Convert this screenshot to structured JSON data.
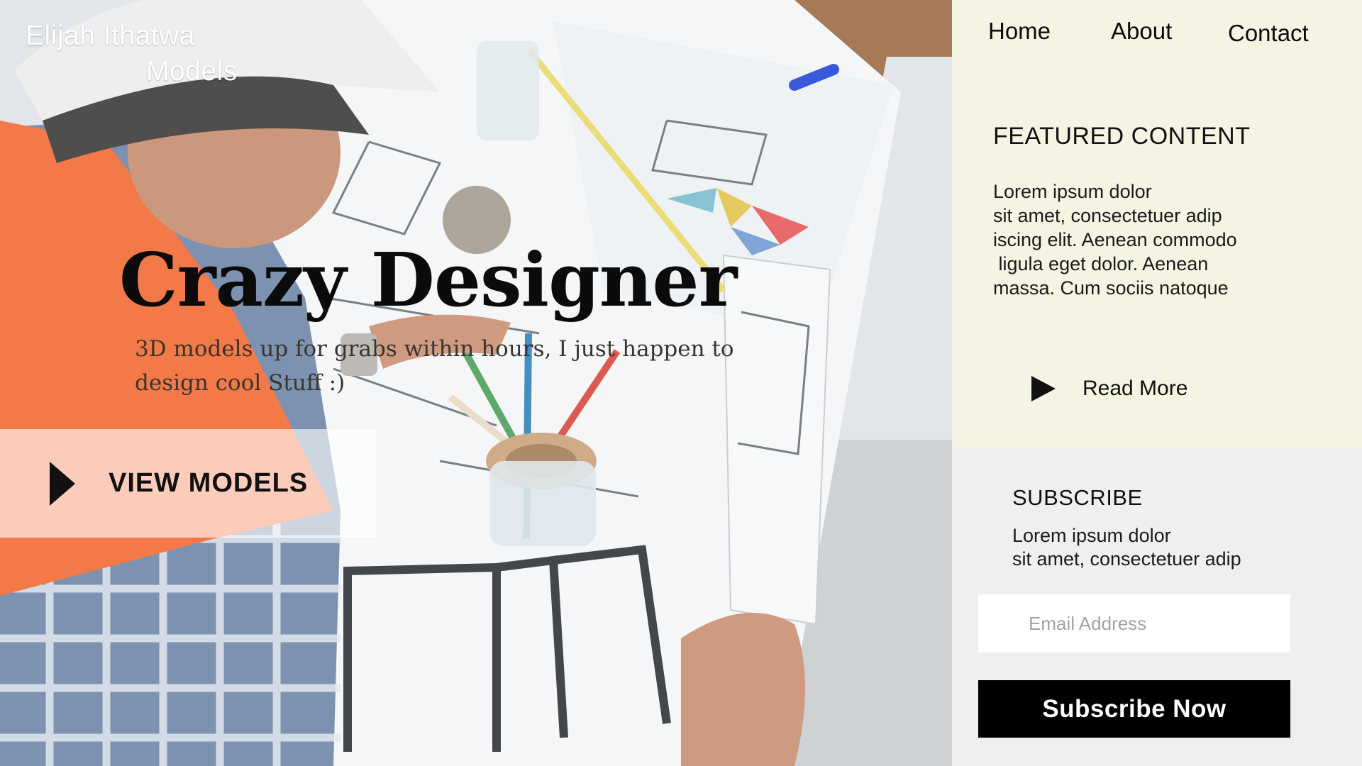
{
  "brand": {
    "line1": "Elijah Ithatwa",
    "line2": "Models"
  },
  "nav": {
    "items": [
      {
        "label": "Home"
      },
      {
        "label": "About"
      },
      {
        "label": "Contact"
      }
    ]
  },
  "hero": {
    "title": "Crazy Designer",
    "subtitle": "3D models up for grabs within hours, I just happen to design cool Stuff :)",
    "cta_label": "VIEW MODELS",
    "cta_icon": "play-triangle-icon"
  },
  "featured": {
    "heading": "FEATURED CONTENT",
    "body_lines": [
      "Lorem ipsum dolor",
      "sit amet, consectetuer adip",
      "iscing elit. Aenean commodo",
      " ligula eget dolor. Aenean",
      "massa. Cum sociis natoque"
    ],
    "read_more_label": "Read More",
    "read_more_icon": "play-triangle-icon"
  },
  "subscribe": {
    "heading": "SUBSCRIBE",
    "body_lines": [
      "Lorem ipsum dolor",
      "sit amet, consectetuer adip"
    ],
    "email_placeholder": "Email Address",
    "button_label": "Subscribe Now"
  },
  "colors": {
    "featured_bg": "#f5f4e2",
    "subscribe_bg": "#efefef",
    "button_bg": "#000000",
    "text_dark": "#111111",
    "vest_orange": "#f26a35"
  }
}
